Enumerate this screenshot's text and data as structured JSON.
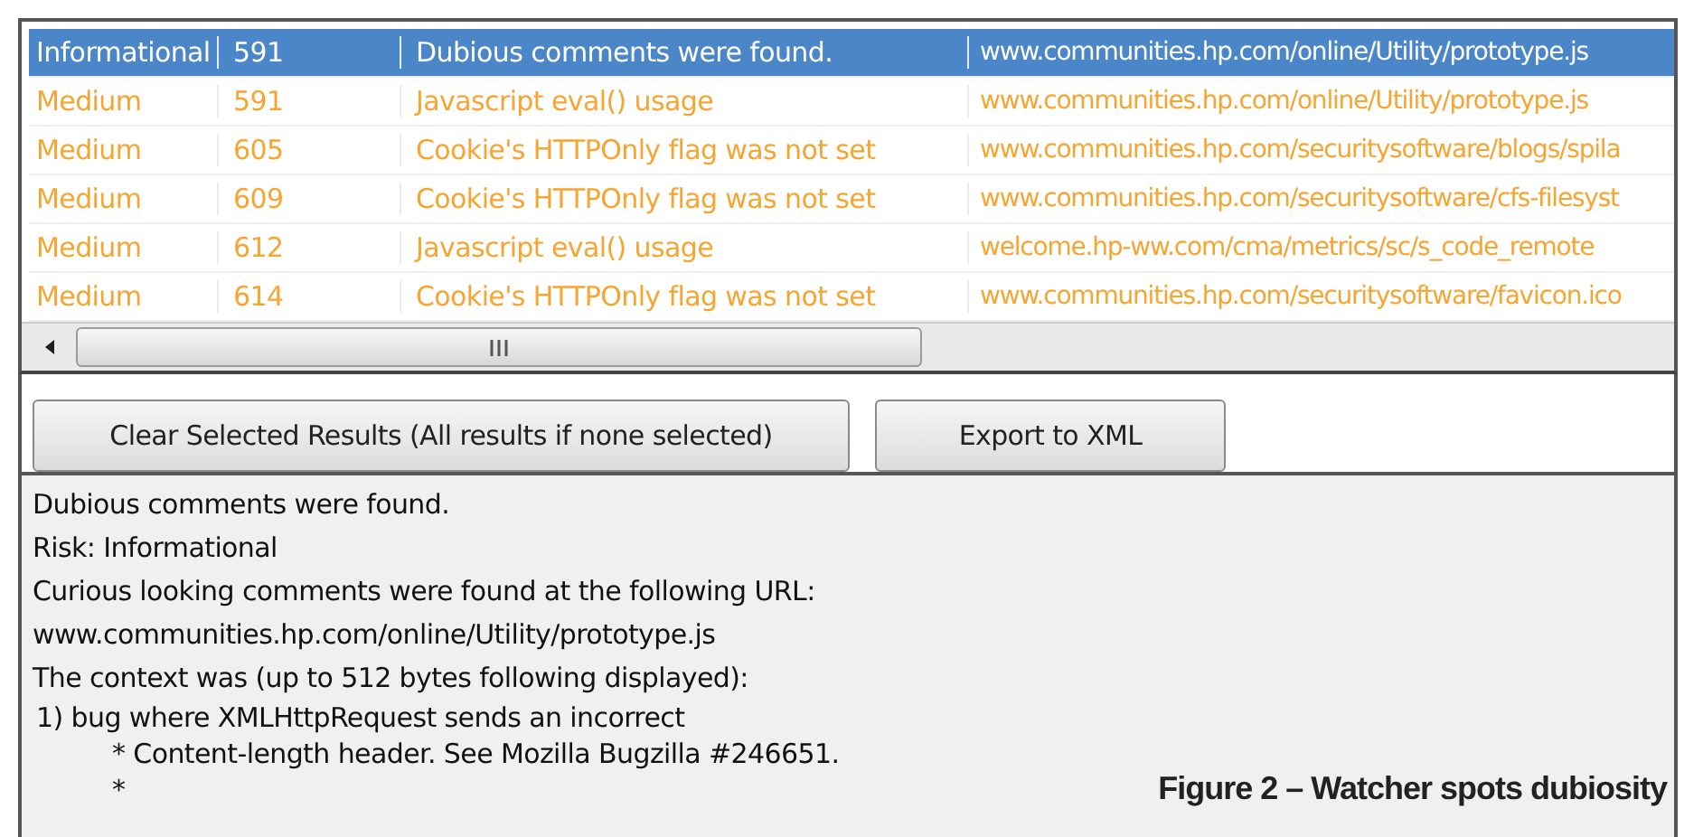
{
  "results_table": {
    "rows": [
      {
        "severity": "Informational",
        "id": "591",
        "description": "Dubious comments were found.",
        "url": "www.communities.hp.com/online/Utility/prototype.js",
        "selected": true
      },
      {
        "severity": "Medium",
        "id": "591",
        "description": "Javascript eval() usage",
        "url": "www.communities.hp.com/online/Utility/prototype.js",
        "selected": false,
        "color": "#f7a531"
      },
      {
        "severity": "Medium",
        "id": "605",
        "description": "Cookie's HTTPOnly flag was not set",
        "url": "www.communities.hp.com/securitysoftware/blogs/spila",
        "selected": false,
        "color": "#f7a531"
      },
      {
        "severity": "Medium",
        "id": "609",
        "description": "Cookie's HTTPOnly flag was not set",
        "url": "www.communities.hp.com/securitysoftware/cfs-filesyst",
        "selected": false,
        "color": "#f7a531"
      },
      {
        "severity": "Medium",
        "id": "612",
        "description": "Javascript eval() usage",
        "url": "welcome.hp-ww.com/cma/metrics/sc/s_code_remote",
        "selected": false,
        "color": "#f7a531"
      },
      {
        "severity": "Medium",
        "id": "614",
        "description": "Cookie's HTTPOnly flag was not set",
        "url": "www.communities.hp.com/securitysoftware/favicon.ico",
        "selected": false,
        "color": "#f7a531"
      }
    ]
  },
  "buttons": [
    "Clear Selected Results (All results if none selected)",
    "Export to XML"
  ],
  "details": {
    "lines": [
      "Dubious comments were found.",
      "Risk: Informational",
      "Curious looking comments were found at the following URL:",
      "www.communities.hp.com/online/Utility/prototype.js",
      "The context was (up to 512 bytes following displayed):"
    ],
    "context": [
      "1) bug where XMLHttpRequest sends an incorrect",
      "* Content-length header. See Mozilla Bugzilla #246651.",
      "*"
    ]
  },
  "caption": "Figure 2 – Watcher spots dubiosity"
}
